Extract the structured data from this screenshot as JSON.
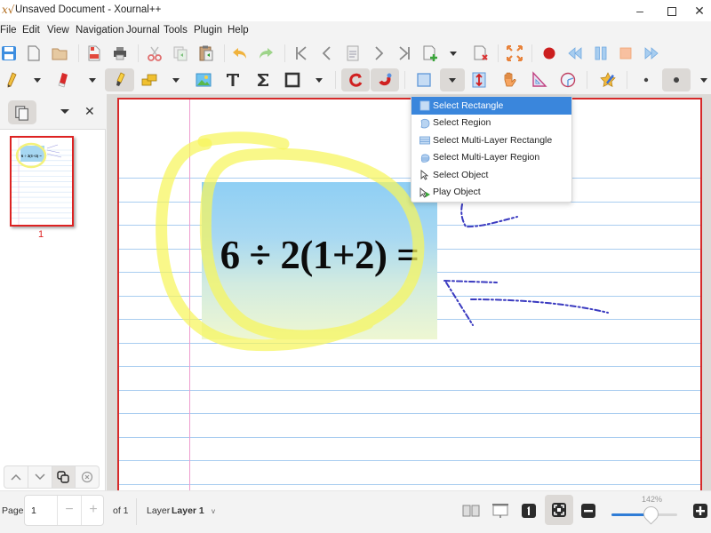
{
  "window": {
    "title": "Unsaved Document - Xournal++",
    "app_icon": "xournal-icon",
    "controls": [
      "minimize",
      "maximize",
      "close"
    ]
  },
  "menubar": {
    "items": [
      "File",
      "Edit",
      "View",
      "Navigation",
      "Journal",
      "Tools",
      "Plugin",
      "Help"
    ]
  },
  "toolbar_top": {
    "buttons": [
      "save",
      "new",
      "open",
      "export-pdf",
      "print",
      "cut",
      "copy",
      "paste",
      "undo",
      "redo",
      "goto-first",
      "goto-back",
      "goto-page",
      "goto-next",
      "goto-last",
      "new-page",
      "new-page-dropdown",
      "delete-page",
      "fullscreen",
      "record",
      "rewind",
      "pause",
      "stop",
      "fast-forward"
    ]
  },
  "toolbar_tools": {
    "buttons": [
      "pen",
      "pen-dropdown",
      "eraser",
      "eraser-dropdown",
      "highlighter",
      "ruler",
      "ruler-dropdown",
      "image",
      "text",
      "tex",
      "shape",
      "shape-dropdown",
      "shape-recognizer",
      "snap",
      "select-rectangle",
      "select-dropdown",
      "vertical-space",
      "hand",
      "setsquare",
      "compass",
      "default-tool",
      "thin-size",
      "medium-size",
      "size-dropdown"
    ],
    "active": [
      "highlighter",
      "shape-recognizer",
      "snap",
      "select-dropdown",
      "medium-size"
    ]
  },
  "select_menu": {
    "items": [
      {
        "label": "Select Rectangle",
        "icon": "select-rectangle-icon",
        "highlighted": true
      },
      {
        "label": "Select Region",
        "icon": "select-region-icon",
        "highlighted": false
      },
      {
        "label": "Select Multi-Layer Rectangle",
        "icon": "select-multilayer-rectangle-icon",
        "highlighted": false
      },
      {
        "label": "Select Multi-Layer Region",
        "icon": "select-multilayer-region-icon",
        "highlighted": false
      },
      {
        "label": "Select Object",
        "icon": "select-object-icon",
        "highlighted": false
      },
      {
        "label": "Play Object",
        "icon": "play-object-icon",
        "highlighted": false
      }
    ]
  },
  "sidebar": {
    "view_button": "page-preview",
    "close_label": "✕",
    "pages": [
      {
        "number": "1",
        "selected": true
      }
    ],
    "footer_buttons": [
      "move-page-up",
      "move-page-down",
      "copy-page",
      "delete-page"
    ]
  },
  "document": {
    "equation_text": "6 ÷ 2(1+2) =",
    "colors": {
      "page_border": "#d62a2a",
      "ruled_line": "#a9cdf0",
      "margin_line": "#ee9ccf",
      "highlighter": "#f6f55c",
      "pen": "#3a3ac0",
      "selection_highlight": "#3a86dc"
    }
  },
  "statusbar": {
    "page_label": "Page",
    "page_value": "1",
    "page_of": "of 1",
    "layer_label": "Layer",
    "layer_value": "Layer 1",
    "layer_caret": "v",
    "zoom_label": "142%",
    "zoom_slider_fraction": 0.6,
    "view_buttons": [
      "dual-page",
      "presentation",
      "zoom-100",
      "zoom-fit",
      "zoom-out",
      "zoom-in"
    ],
    "active_view": "zoom-fit"
  }
}
